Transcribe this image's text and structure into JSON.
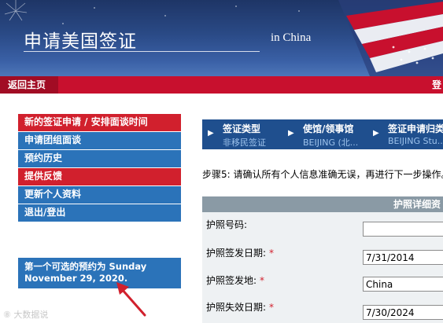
{
  "header": {
    "title": "申请美国签证",
    "subtitle": "in China"
  },
  "nav": {
    "home_label": "返回主页",
    "right_label": "登"
  },
  "menu": {
    "items": [
      {
        "label": "新的签证申请 / 安排面谈时间",
        "style": "red"
      },
      {
        "label": "申请团组面谈",
        "style": "blue"
      },
      {
        "label": "预约历史",
        "style": "blue"
      },
      {
        "label": "提供反馈",
        "style": "red"
      },
      {
        "label": "更新个人资料",
        "style": "blue"
      },
      {
        "label": "退出/登出",
        "style": "blue"
      }
    ]
  },
  "availability": {
    "line1": "第一个可选的预约为 Sunday",
    "line2": "November 29, 2020."
  },
  "steps": [
    {
      "label": "签证类型",
      "value": "非移民签证"
    },
    {
      "label": "使馆/领事馆",
      "value": "BEIJING (北..."
    },
    {
      "label": "签证申请归类",
      "value": "BEIJING Stu..."
    }
  ],
  "step_instruction": "步骤5: 请确认所有个人信息准确无误，再进行下一步操作。",
  "passport": {
    "header": "护照详细资",
    "fields": [
      {
        "label": "护照号码:",
        "required": false,
        "value": ""
      },
      {
        "label": "护照签发日期:",
        "required": true,
        "value": "7/31/2014"
      },
      {
        "label": "护照签发地:",
        "required": true,
        "value": "China"
      },
      {
        "label": "护照失效日期:",
        "required": true,
        "value": "7/30/2024"
      }
    ]
  },
  "watermark": "大数据说",
  "colors": {
    "red": "#c8102e",
    "blue": "#2b73b9",
    "navy": "#1f4f8e",
    "required": "#d1202d"
  }
}
